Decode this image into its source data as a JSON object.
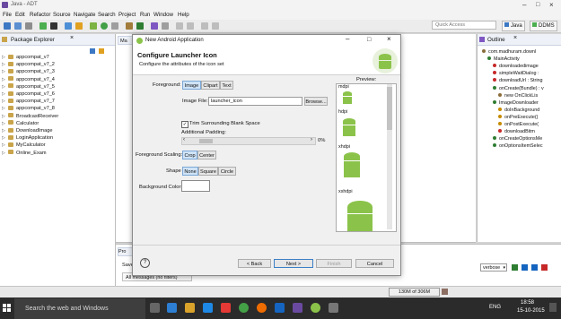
{
  "window": {
    "title": "Java - ADT"
  },
  "menu": [
    "File",
    "Edit",
    "Refactor",
    "Source",
    "Navigate",
    "Search",
    "Project",
    "Run",
    "Window",
    "Help"
  ],
  "toolbar": {
    "quick_access_placeholder": "Quick Access",
    "perspective_java": "Java",
    "perspective_ddms": "DDMS"
  },
  "package_explorer": {
    "title": "Package Explorer",
    "items": [
      {
        "label": "appcompat_v7",
        "type": "project"
      },
      {
        "label": "appcompat_v7_2",
        "type": "project"
      },
      {
        "label": "appcompat_v7_3",
        "type": "project"
      },
      {
        "label": "appcompat_v7_4",
        "type": "project"
      },
      {
        "label": "appcompat_v7_5",
        "type": "project"
      },
      {
        "label": "appcompat_v7_6",
        "type": "project"
      },
      {
        "label": "appcompat_v7_7",
        "type": "project"
      },
      {
        "label": "appcompat_v7_8",
        "type": "project"
      },
      {
        "label": "BroadcastReceiver",
        "type": "project"
      },
      {
        "label": "Calculator",
        "type": "project"
      },
      {
        "label": "DownloadImage",
        "type": "project"
      },
      {
        "label": "LoginApplication",
        "type": "project"
      },
      {
        "label": "MyCalculator",
        "type": "project"
      },
      {
        "label": "Online_Exam",
        "type": "project"
      }
    ]
  },
  "editor": {
    "tab": "Ma"
  },
  "outline": {
    "title": "Outline",
    "items": [
      {
        "label": "com.madhuram.downl",
        "indent": 0,
        "color": "#8a6d3b"
      },
      {
        "label": "MainActivity",
        "indent": 1,
        "color": "#2e7d32"
      },
      {
        "label": "downloadedimage",
        "indent": 2,
        "color": "#c62828"
      },
      {
        "label": "simpleWaitDialog : ",
        "indent": 2,
        "color": "#c62828"
      },
      {
        "label": "downloadUrl : String",
        "indent": 2,
        "color": "#c62828"
      },
      {
        "label": "onCreate(Bundle) : v",
        "indent": 2,
        "color": "#2e7d32"
      },
      {
        "label": "new OnClickLis",
        "indent": 3,
        "color": "#8a6d3b"
      },
      {
        "label": "ImageDownloader",
        "indent": 2,
        "color": "#2e7d32"
      },
      {
        "label": "doInBackground",
        "indent": 3,
        "color": "#c68b00"
      },
      {
        "label": "onPreExecute()",
        "indent": 3,
        "color": "#c68b00"
      },
      {
        "label": "onPostExecute(",
        "indent": 3,
        "color": "#c68b00"
      },
      {
        "label": "downloadBitm",
        "indent": 3,
        "color": "#c62828"
      },
      {
        "label": "onCreateOptionsMe",
        "indent": 2,
        "color": "#2e7d32"
      },
      {
        "label": "onOptionsItemSelec",
        "indent": 2,
        "color": "#2e7d32"
      }
    ]
  },
  "logcat": {
    "tab": "Pro",
    "save_label": "Save",
    "filter": "All messages (no filters)",
    "level": "verbose"
  },
  "statusbar": {
    "memory": "130M of 306M"
  },
  "taskbar": {
    "search_placeholder": "Search the web and Windows",
    "lang": "ENG",
    "time": "18:58",
    "date": "15-10-2015"
  },
  "dialog": {
    "window_title": "New Android Application",
    "heading": "Configure Launcher Icon",
    "subheading": "Configure the attributes of the icon set",
    "foreground_label": "Foreground:",
    "foreground_options": [
      "Image",
      "Clipart",
      "Text"
    ],
    "foreground_selected": "Image",
    "image_file_label": "Image File:",
    "image_file_value": "launcher_icon",
    "browse_label": "Browse...",
    "trim_label": "Trim Surrounding Blank Space",
    "trim_checked": true,
    "padding_label": "Additional Padding:",
    "padding_value": "0%",
    "padding_level": 0,
    "scaling_label": "Foreground Scaling:",
    "scaling_options": [
      "Crop",
      "Center"
    ],
    "scaling_selected": "Crop",
    "shape_label": "Shape",
    "shape_options": [
      "None",
      "Square",
      "Circle"
    ],
    "shape_selected": "None",
    "bgcolor_label": "Background Color:",
    "bgcolor_value": "#ffffff",
    "preview_label": "Preview:",
    "densities": [
      "mdpi",
      "hdpi",
      "xhdpi",
      "xxhdpi"
    ],
    "help_label": "?",
    "back_label": "< Back",
    "next_label": "Next >",
    "finish_label": "Finish",
    "cancel_label": "Cancel"
  }
}
